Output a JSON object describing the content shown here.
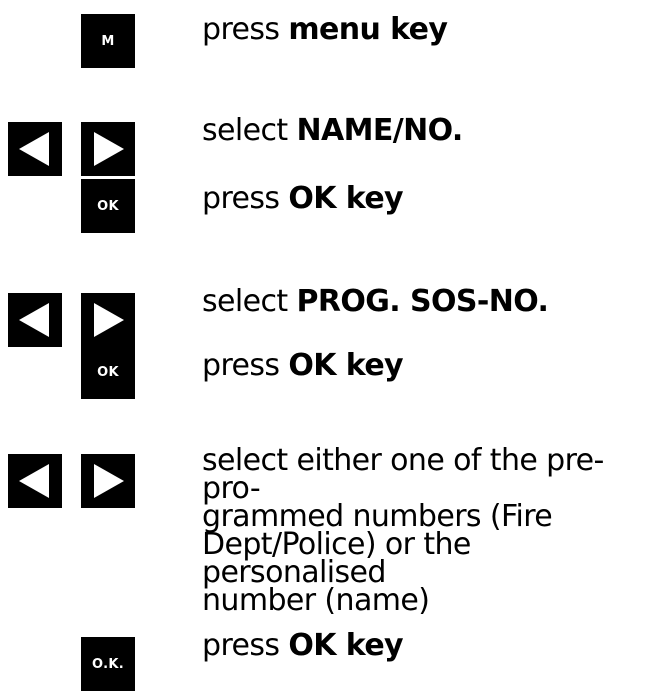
{
  "steps": [
    {
      "key_label": "M",
      "verb": "press",
      "emphasis": "menu key"
    },
    {
      "key_icons": [
        "left-arrow",
        "right-arrow"
      ],
      "verb": "select",
      "emphasis": "NAME/NO."
    },
    {
      "key_label": "OK",
      "verb": "press",
      "emphasis": "OK key"
    },
    {
      "key_icons": [
        "left-arrow",
        "right-arrow"
      ],
      "verb": "select",
      "emphasis": "PROG. SOS-NO."
    },
    {
      "key_label": "OK",
      "verb": "press",
      "emphasis": "OK key"
    },
    {
      "key_icons": [
        "left-arrow",
        "right-arrow"
      ],
      "lines": [
        "select either one of the pre-pro-",
        "grammed numbers (Fire",
        "Dept/Police) or the personalised",
        "number (name)"
      ]
    },
    {
      "key_label": "O.K.",
      "verb": "press",
      "emphasis": "OK key"
    }
  ],
  "colors": {
    "key_background": "#000000",
    "key_text": "#ffffff",
    "text": "#000000",
    "page_background": "#ffffff"
  }
}
